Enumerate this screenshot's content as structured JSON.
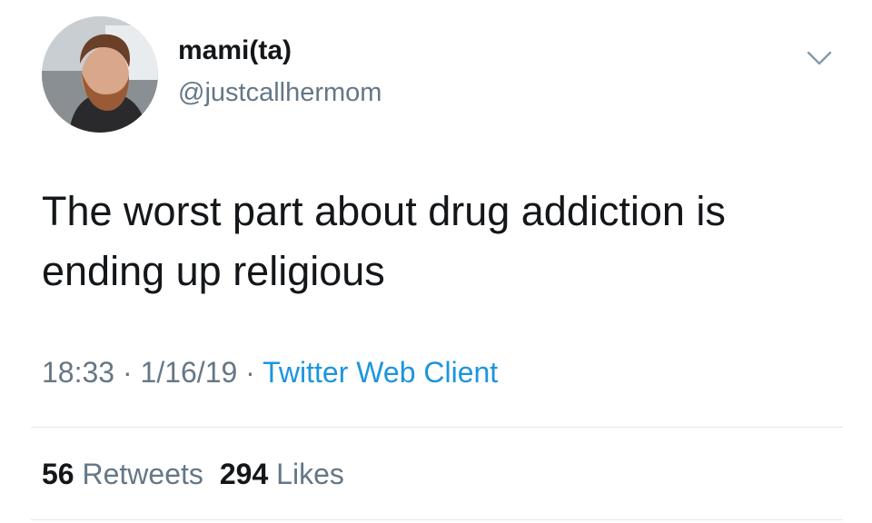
{
  "user": {
    "display_name": "mami(ta)",
    "handle": "@justcallhermom"
  },
  "tweet": {
    "text": "The worst part about drug addiction is ending up religious",
    "time": "18:33",
    "date": "1/16/19",
    "separator": "·",
    "client": "Twitter Web Client"
  },
  "stats": {
    "retweets_count": "56",
    "retweets_label": "Retweets",
    "likes_count": "294",
    "likes_label": "Likes"
  },
  "icons": {
    "menu": "chevron-down-icon"
  },
  "colors": {
    "text": "#14171a",
    "secondary": "#657786",
    "link": "#1b95e0",
    "divider": "#e1e8ed"
  }
}
